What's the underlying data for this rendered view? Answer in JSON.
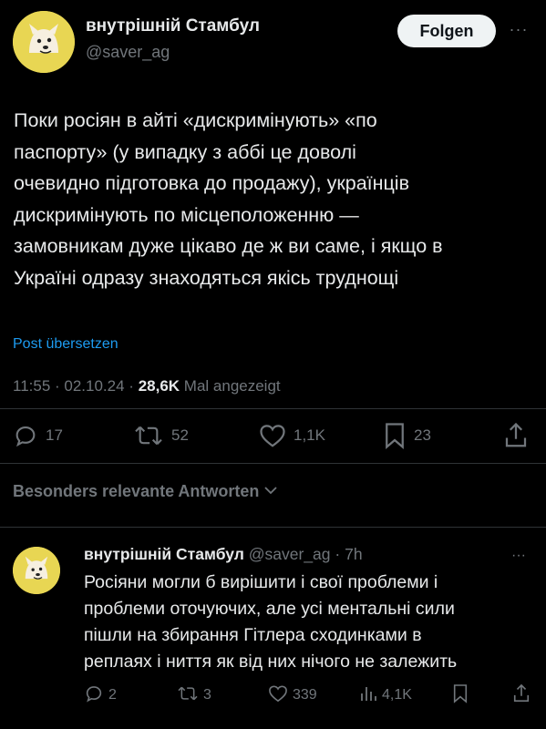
{
  "tweet": {
    "author": {
      "display_name": "внутрішній Стамбул",
      "handle": "@saver_ag"
    },
    "follow_label": "Folgen",
    "more_label": "···",
    "text_lines": [
      "Поки росіян в айті «дискримінують» «по",
      "паспорту» (у випадку з аббі це доволі",
      "очевидно підготовка до продажу), українців",
      "дискримінують по місцеположенню —",
      "замовникам дуже цікаво де ж ви саме, і якщо в",
      "Україні одразу знаходяться якісь труднощі"
    ],
    "translate_label": "Post übersetzen",
    "time": "11:55",
    "date": "02.10.24",
    "views_count": "28,6K",
    "views_label": "Mal angezeigt",
    "stats": {
      "replies": "17",
      "reposts": "52",
      "likes": "1,1K",
      "bookmarks": "23"
    }
  },
  "replies_section": {
    "sort_label": "Besonders relevante Antworten"
  },
  "reply": {
    "author": {
      "display_name": "внутрішній Стамбул",
      "handle": "@saver_ag",
      "age": "7h"
    },
    "more_label": "···",
    "text_lines": [
      "Росіяни могли б вирішити і свої проблеми і",
      "проблеми оточуючих, але усі ментальні сили",
      "пішли на збирання Гітлера сходинками в",
      "реплаях і ниття як від них нічого не залежить"
    ],
    "stats": {
      "replies": "2",
      "reposts": "3",
      "likes": "339",
      "views": "4,1K"
    }
  },
  "colors": {
    "background": "#000000",
    "text": "#e7e9ea",
    "muted": "#71767b",
    "accent": "#1d9bf0",
    "avatar": "#e8d653"
  }
}
